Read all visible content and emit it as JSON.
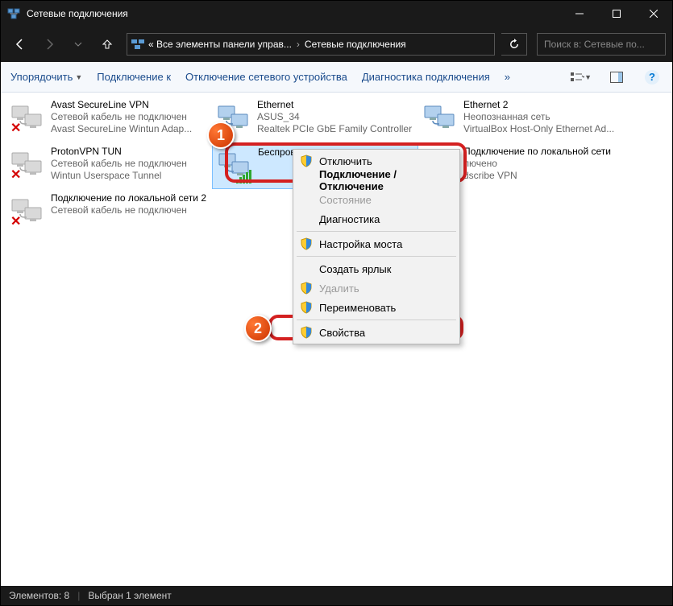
{
  "titlebar": {
    "title": "Сетевые подключения"
  },
  "breadcrumb": {
    "root": "« Все элементы панели управ...",
    "current": "Сетевые подключения"
  },
  "search": {
    "placeholder": "Поиск в: Сетевые по..."
  },
  "toolbar": {
    "organize": "Упорядочить",
    "connect": "Подключение к",
    "disable": "Отключение сетевого устройства",
    "diagnose": "Диагностика подключения"
  },
  "connections": [
    {
      "name": "Avast SecureLine VPN",
      "status": "Сетевой кабель не подключен",
      "device": "Avast SecureLine Wintun Adap...",
      "disabled": true
    },
    {
      "name": "Ethernet",
      "status": "ASUS_34",
      "device": "Realtek PCIe GbE Family Controller",
      "disabled": false
    },
    {
      "name": "Ethernet 2",
      "status": "Неопознанная сеть",
      "device": "VirtualBox Host-Only Ethernet Ad...",
      "disabled": false
    },
    {
      "name": "ProtonVPN TUN",
      "status": "Сетевой кабель не подключен",
      "device": "Wintun Userspace Tunnel",
      "disabled": true
    },
    {
      "name": "Беспроводная сеть",
      "status": "",
      "device": "",
      "disabled": false,
      "wifi": true,
      "selected": true
    },
    {
      "name": "Подключение по локальной сети",
      "status": "лючено",
      "device": "dscribe VPN",
      "disabled": true
    },
    {
      "name": "Подключение по локальной сети 2",
      "status": "Сетевой кабель не подключен",
      "device": "",
      "disabled": true
    }
  ],
  "context_menu": {
    "disconnect": "Отключить",
    "connect_disconnect": "Подключение / Отключение",
    "state": "Состояние",
    "diagnostics": "Диагностика",
    "bridge": "Настройка моста",
    "shortcut": "Создать ярлык",
    "delete": "Удалить",
    "rename": "Переименовать",
    "properties": "Свойства"
  },
  "badges": {
    "b1": "1",
    "b2": "2"
  },
  "statusbar": {
    "items": "Элементов: 8",
    "selected": "Выбран 1 элемент"
  }
}
